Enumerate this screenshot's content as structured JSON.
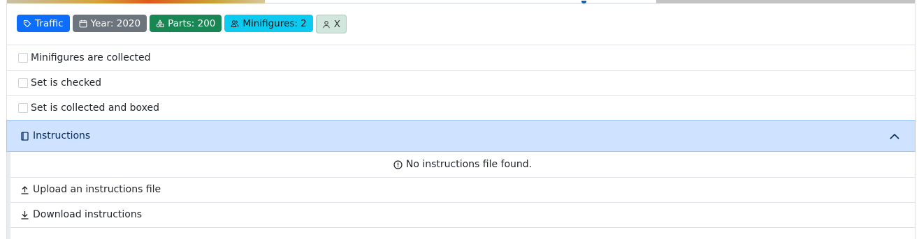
{
  "badges": [
    {
      "label": "Traffic",
      "icon": "tag-icon",
      "color": "#0d6efd"
    },
    {
      "label": "Year: 2020",
      "icon": "calendar-icon",
      "color": "#6c757d"
    },
    {
      "label": "Parts: 200",
      "icon": "shapes-icon",
      "color": "#198754"
    },
    {
      "label": "Minifigures: 2",
      "icon": "group-icon",
      "color": "#0dcaf0"
    },
    {
      "label": "X",
      "icon": "user-icon",
      "color": "#d1e7dd"
    }
  ],
  "checks": [
    {
      "label": "Minifigures are collected",
      "checked": false
    },
    {
      "label": "Set is checked",
      "checked": false
    },
    {
      "label": "Set is collected and boxed",
      "checked": false
    }
  ],
  "instructions": {
    "title": "Instructions",
    "expanded": true,
    "empty_message": "No instructions file found.",
    "upload_label": "Upload an instructions file",
    "download_label": "Download instructions"
  },
  "colors": {
    "accordion_bg": "#cfe2ff",
    "accordion_text": "#052c65"
  }
}
